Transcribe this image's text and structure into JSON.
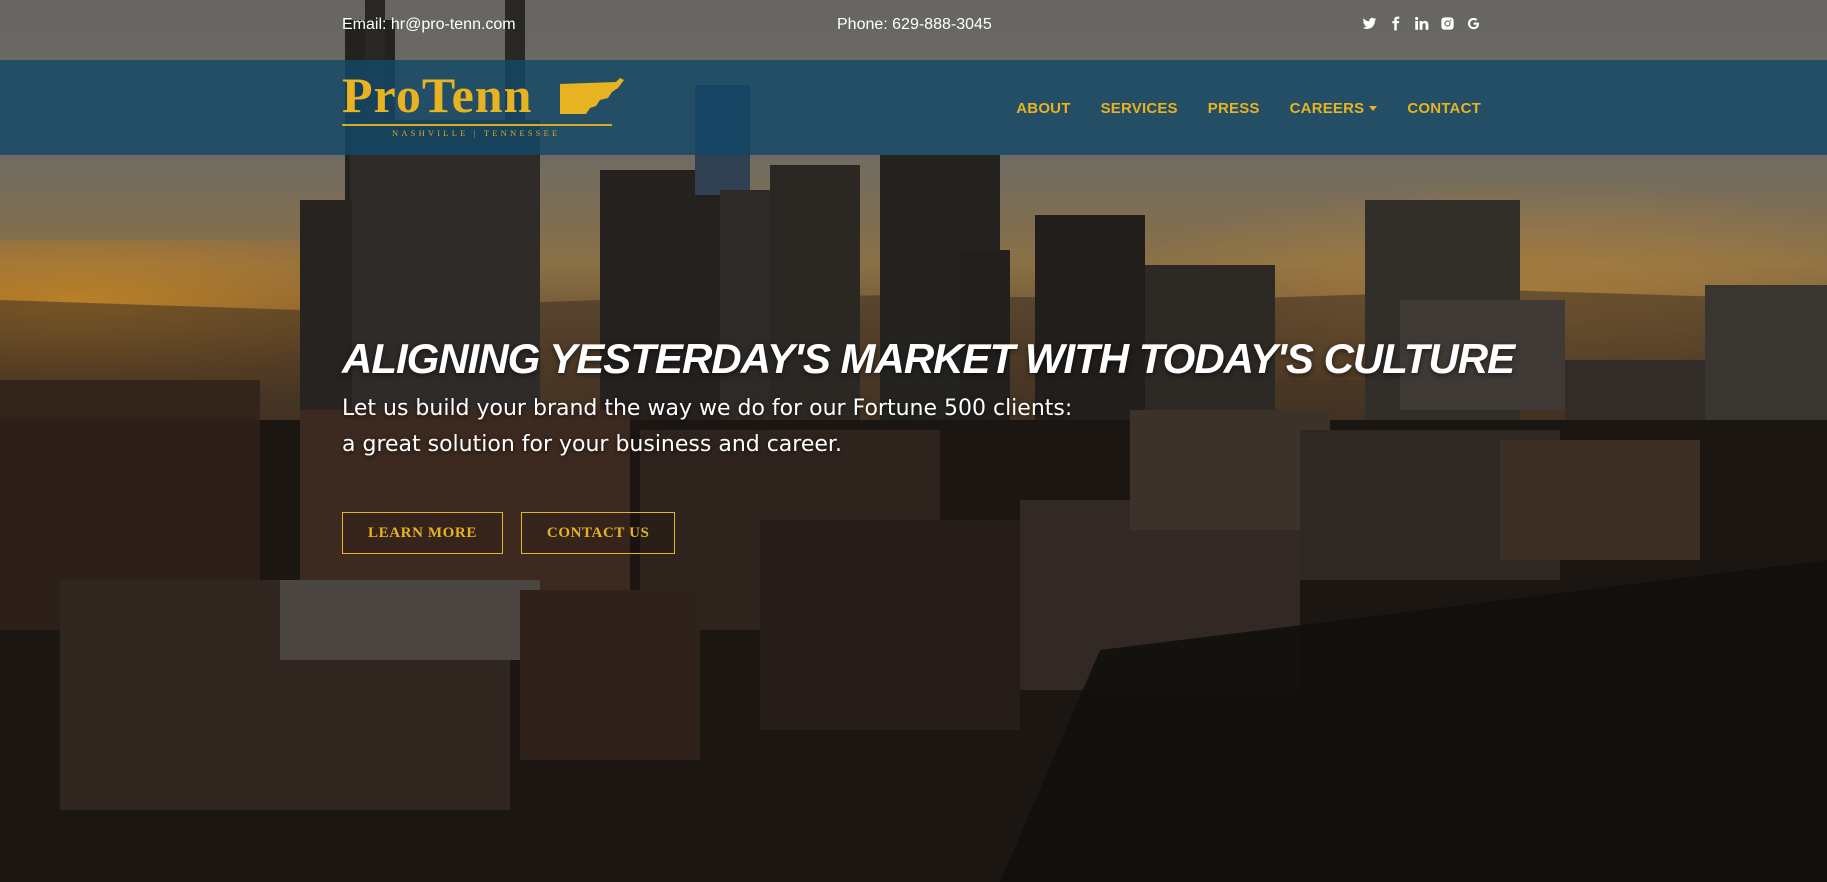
{
  "topbar": {
    "email": "Email: hr@pro-tenn.com",
    "phone": "Phone: 629-888-3045",
    "social": [
      "twitter-icon",
      "facebook-icon",
      "linkedin-icon",
      "instagram-icon",
      "google-icon"
    ]
  },
  "logo": {
    "name": "ProTenn",
    "tagline": "NASHVILLE | TENNESSEE"
  },
  "nav": {
    "items": [
      {
        "label": "ABOUT"
      },
      {
        "label": "SERVICES"
      },
      {
        "label": "PRESS"
      },
      {
        "label": "CAREERS"
      },
      {
        "label": "CONTACT"
      }
    ]
  },
  "hero": {
    "headline": "ALIGNING YESTERDAY'S MARKET WITH TODAY'S CULTURE",
    "line1": "Let us build your brand the way we do for our Fortune 500 clients:",
    "line2": "a great solution for your business and career.",
    "learn_more": "LEARN MORE",
    "contact_us": "CONTACT US"
  },
  "colors": {
    "accent": "#e8b320",
    "navbar": "#124868"
  }
}
